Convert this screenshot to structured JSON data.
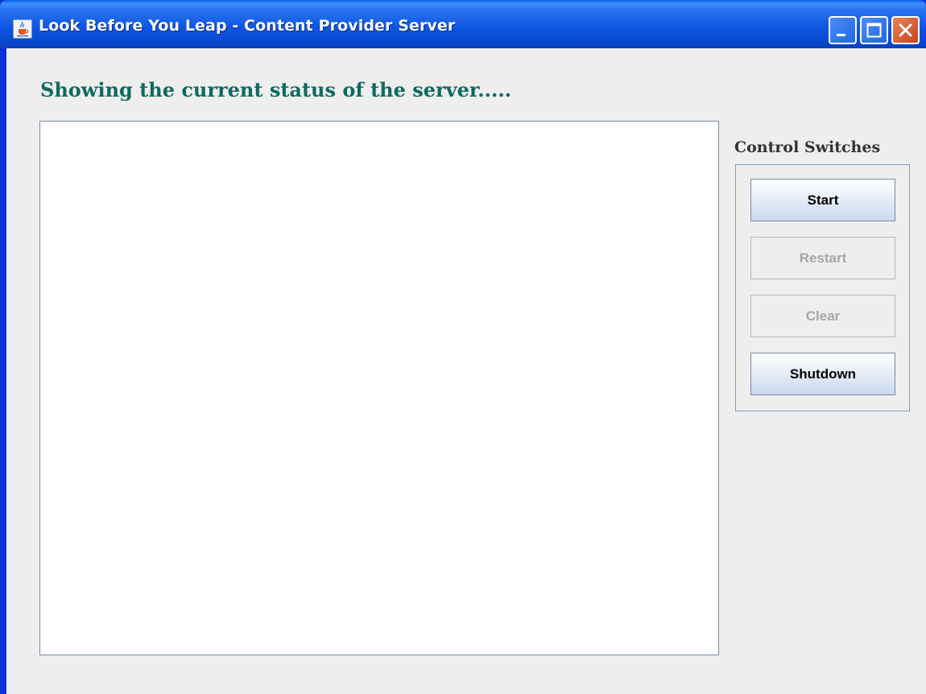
{
  "window": {
    "title": "Look Before You Leap - Content Provider Server",
    "icon": "java-cup-icon",
    "controls": [
      "minimize-icon",
      "maximize-icon",
      "close-icon"
    ]
  },
  "main": {
    "heading": "Showing the current status of the server.....",
    "status_text": ""
  },
  "controls": {
    "label": "Control Switches",
    "buttons": [
      {
        "label": "Start",
        "enabled": true
      },
      {
        "label": "Restart",
        "enabled": false
      },
      {
        "label": "Clear",
        "enabled": false
      },
      {
        "label": "Shutdown",
        "enabled": true
      }
    ]
  },
  "colors": {
    "heading": "#0e6a5f",
    "titlebar": "#0b54e0",
    "close_button": "#c9441d"
  }
}
